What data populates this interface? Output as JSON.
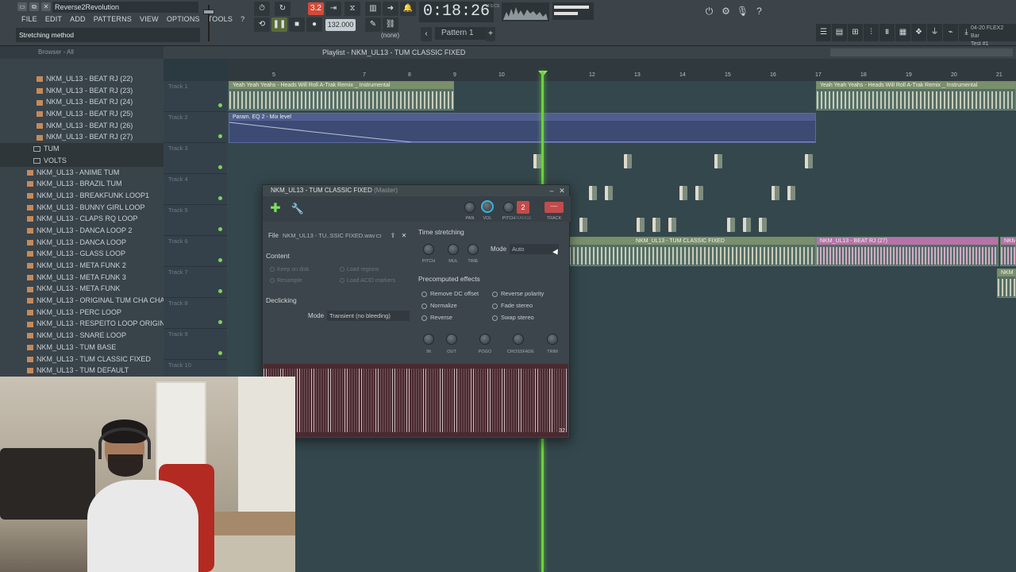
{
  "app": {
    "project_title": "Reverse2Revolution",
    "window_controls": [
      "▭",
      "⧉",
      "✕"
    ]
  },
  "menu": [
    "FILE",
    "EDIT",
    "ADD",
    "PATTERNS",
    "VIEW",
    "OPTIONS",
    "TOOLS",
    "?"
  ],
  "hint_bar": "Stretching method",
  "transport": {
    "song_position": "3.2",
    "tempo": "132.000",
    "time": "0:18:26",
    "time_unit": "M:S:CS",
    "pattern": "Pattern 1",
    "none_selector": "(none)"
  },
  "news_panel": {
    "line1": "04-20  FLEX2 Bar",
    "line2": "Test #1"
  },
  "browser": {
    "header": "Browser - All",
    "items": [
      {
        "label": "NKM_UL13 - BEAT RJ (22)",
        "type": "file",
        "indent": 46
      },
      {
        "label": "NKM_UL13 - BEAT RJ (23)",
        "type": "file",
        "indent": 46
      },
      {
        "label": "NKM_UL13 - BEAT RJ (24)",
        "type": "file",
        "indent": 46
      },
      {
        "label": "NKM_UL13 - BEAT RJ (25)",
        "type": "file",
        "indent": 46
      },
      {
        "label": "NKM_UL13 - BEAT RJ (26)",
        "type": "file",
        "indent": 46
      },
      {
        "label": "NKM_UL13 - BEAT RJ (27)",
        "type": "file",
        "indent": 46
      },
      {
        "label": "TUM",
        "type": "folder",
        "indent": 42
      },
      {
        "label": "VOLTS",
        "type": "folder",
        "indent": 42
      },
      {
        "label": "NKM_UL13 - ANIME TUM",
        "type": "file",
        "indent": 34
      },
      {
        "label": "NKM_UL13 - BRAZIL TUM",
        "type": "file",
        "indent": 34
      },
      {
        "label": "NKM_UL13 - BREAKFUNK LOOP1",
        "type": "file",
        "indent": 34
      },
      {
        "label": "NKM_UL13 - BUNNY GIRL LOOP",
        "type": "file",
        "indent": 34
      },
      {
        "label": "NKM_UL13 - CLAPS RQ LOOP",
        "type": "file",
        "indent": 34
      },
      {
        "label": "NKM_UL13 - DANCA LOOP 2",
        "type": "file",
        "indent": 34
      },
      {
        "label": "NKM_UL13 - DANCA LOOP",
        "type": "file",
        "indent": 34
      },
      {
        "label": "NKM_UL13 - GLASS LOOP",
        "type": "file",
        "indent": 34
      },
      {
        "label": "NKM_UL13 - META FUNK 2",
        "type": "file",
        "indent": 34
      },
      {
        "label": "NKM_UL13 - META FUNK 3",
        "type": "file",
        "indent": 34
      },
      {
        "label": "NKM_UL13 - META FUNK",
        "type": "file",
        "indent": 34
      },
      {
        "label": "NKM_UL13 - ORIGINAL TUM CHA CHA",
        "type": "file",
        "indent": 34
      },
      {
        "label": "NKM_UL13 - PERC LOOP",
        "type": "file",
        "indent": 34
      },
      {
        "label": "NKM_UL13 - RESPEITO LOOP ORIGINAL",
        "type": "file",
        "indent": 34
      },
      {
        "label": "NKM_UL13 - SNARE LOOP",
        "type": "file",
        "indent": 34
      },
      {
        "label": "NKM_UL13 - TUM BASE",
        "type": "file",
        "indent": 34
      },
      {
        "label": "NKM_UL13 - TUM CLASSIC FIXED",
        "type": "file",
        "indent": 34
      },
      {
        "label": "NKM_UL13 - TUM DEFAULT",
        "type": "file",
        "indent": 34
      }
    ]
  },
  "playlist": {
    "title": "Playlist - NKM_UL13 - TUM CLASSIC FIXED",
    "bar_numbers": [
      "5",
      "7",
      "8",
      "9",
      "10",
      "12",
      "13",
      "14",
      "15",
      "16",
      "17",
      "18",
      "19",
      "20",
      "21"
    ],
    "tracks": [
      "Track 1",
      "Track 2",
      "Track 3",
      "Track 4",
      "Track 5",
      "Track 6",
      "Track 7",
      "Track 8",
      "Track 9",
      "Track 10"
    ],
    "clip_yeah": "Yeah Yeah Yeahs - Heads Will Roll A-Trak Remix _ Instrumental",
    "clip_param": "Param. EQ 2 - Mix level",
    "clip_tum": "NKM_UL13 - TUM CLASSIC FIXED",
    "clip_beat": "NKM_UL13 - BEAT RJ (27)",
    "clip_nkm": "NKM"
  },
  "channel": {
    "title": "NKM_UL13 - TUM CLASSIC FIXED",
    "title_suffix": "(Master)",
    "knobs_top": [
      "PAN",
      "VOL",
      "PITCH",
      "RANGE",
      "TRACK"
    ],
    "track_number": "2",
    "track_btn": "----",
    "file_label": "File",
    "file_name": "NKM_UL13 - TU..SSIC FIXED.wav",
    "content_title": "Content",
    "content_opts": [
      "Keep on disk",
      "Load regions",
      "Resample",
      "Load ACID markers"
    ],
    "declicking_title": "Declicking",
    "declick_mode_label": "Mode",
    "declick_mode_value": "Transient (no bleeding)",
    "time_stretch_title": "Time stretching",
    "ts_knobs": [
      "PITCH",
      "MUL",
      "TIME"
    ],
    "ts_mode_label": "Mode",
    "ts_mode_value": "Auto",
    "precomputed_title": "Precomputed effects",
    "effects": [
      "Remove DC offset",
      "Reverse polarity",
      "Normalize",
      "Fade stereo",
      "Reverse",
      "Swap stereo"
    ],
    "effect_knobs": [
      "IN",
      "OUT",
      "POGO",
      "CROSSFADE",
      "TRIM"
    ],
    "sample_zoom": "32"
  }
}
